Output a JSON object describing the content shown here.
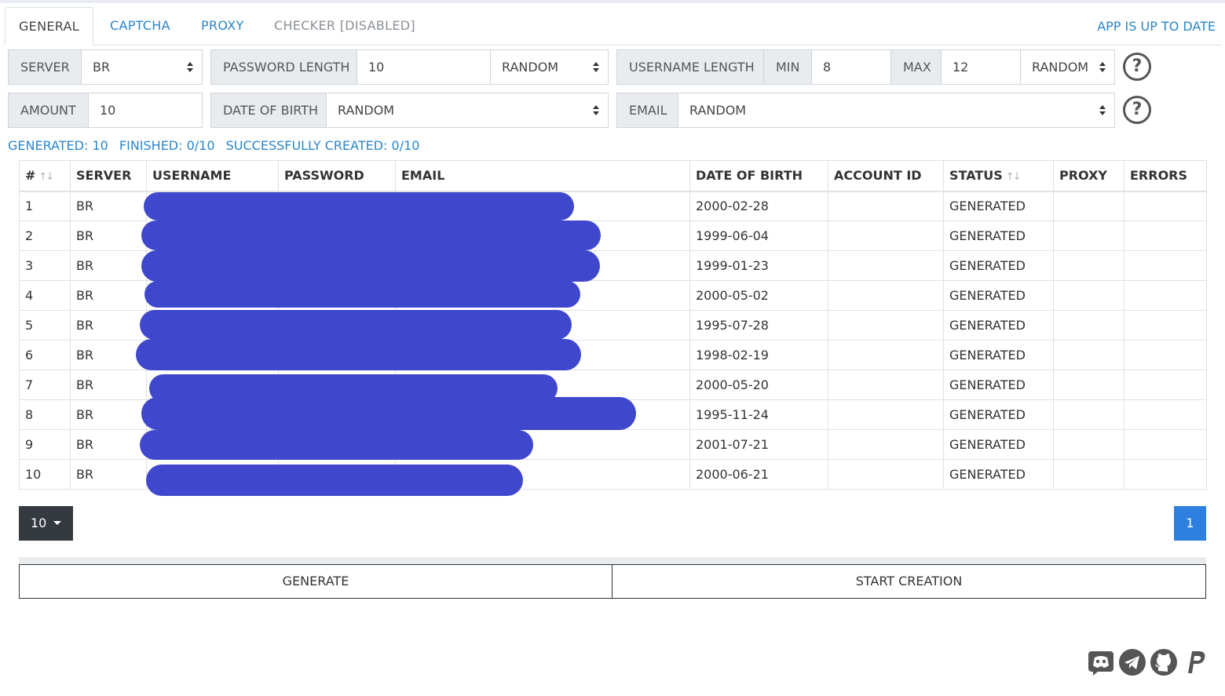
{
  "tabs": {
    "general": "GENERAL",
    "captcha": "CAPTCHA",
    "proxy": "PROXY",
    "checker": "CHECKER [DISABLED]"
  },
  "app_status": "APP IS UP TO DATE",
  "form": {
    "server_label": "SERVER",
    "server_value": "BR",
    "password_length_label": "PASSWORD LENGTH",
    "password_length_value": "10",
    "password_mode": "RANDOM",
    "username_length_label": "USERNAME LENGTH",
    "min_label": "MIN",
    "min_value": "8",
    "max_label": "MAX",
    "max_value": "12",
    "username_mode": "RANDOM",
    "amount_label": "AMOUNT",
    "amount_value": "10",
    "dob_label": "DATE OF BIRTH",
    "dob_value": "RANDOM",
    "email_label": "EMAIL",
    "email_value": "RANDOM",
    "help_glyph": "?"
  },
  "stats": {
    "generated": "GENERATED: 10",
    "finished": "FINISHED: 0/10",
    "created": "SUCCESSFULLY CREATED: 0/10"
  },
  "table": {
    "headers": [
      "#",
      "SERVER",
      "USERNAME",
      "PASSWORD",
      "EMAIL",
      "DATE OF BIRTH",
      "ACCOUNT ID",
      "STATUS",
      "PROXY",
      "ERRORS"
    ],
    "sort_glyph": "↑↓",
    "rows": [
      {
        "n": "1",
        "server": "BR",
        "dob": "2000-02-28",
        "status": "GENERATED"
      },
      {
        "n": "2",
        "server": "BR",
        "dob": "1999-06-04",
        "status": "GENERATED"
      },
      {
        "n": "3",
        "server": "BR",
        "dob": "1999-01-23",
        "status": "GENERATED"
      },
      {
        "n": "4",
        "server": "BR",
        "dob": "2000-05-02",
        "status": "GENERATED"
      },
      {
        "n": "5",
        "server": "BR",
        "dob": "1995-07-28",
        "status": "GENERATED"
      },
      {
        "n": "6",
        "server": "BR",
        "dob": "1998-02-19",
        "status": "GENERATED"
      },
      {
        "n": "7",
        "server": "BR",
        "dob": "2000-05-20",
        "status": "GENERATED"
      },
      {
        "n": "8",
        "server": "BR",
        "dob": "1995-11-24",
        "status": "GENERATED"
      },
      {
        "n": "9",
        "server": "BR",
        "dob": "2001-07-21",
        "status": "GENERATED"
      },
      {
        "n": "10",
        "server": "BR",
        "dob": "2000-06-21",
        "status": "GENERATED"
      }
    ]
  },
  "pager": {
    "page_size": "10",
    "current_page": "1"
  },
  "buttons": {
    "generate": "GENERATE",
    "start": "START CREATION"
  },
  "social_icons": [
    "discord-icon",
    "telegram-icon",
    "github-icon",
    "paypal-icon"
  ],
  "colors": {
    "link": "#2a86c8",
    "redaction": "#3f47cc",
    "page_active": "#2d7fe0",
    "dark_button": "#343a40"
  }
}
